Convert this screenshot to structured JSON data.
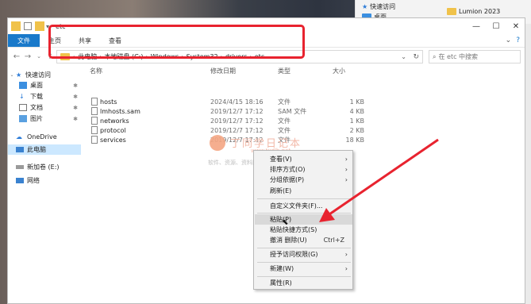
{
  "background": {
    "right_panel_items": [
      "快速访问",
      "桌面",
      "Lumion 2023"
    ]
  },
  "window": {
    "title": "etc",
    "ribbon_tabs": [
      "文件",
      "主页",
      "共享",
      "查看"
    ],
    "address": {
      "crumbs": [
        "此电脑",
        "本地磁盘 (C:)",
        "Windows",
        "System32",
        "drivers",
        "etc"
      ]
    },
    "search_placeholder": "在 etc 中搜索"
  },
  "sidebar": {
    "items": [
      {
        "label": "快速访问",
        "icon": "star-icon"
      },
      {
        "label": "桌面",
        "icon": "desktop-folder-icon"
      },
      {
        "label": "下载",
        "icon": "download-icon"
      },
      {
        "label": "文档",
        "icon": "document-icon"
      },
      {
        "label": "图片",
        "icon": "picture-icon"
      },
      {
        "label": "OneDrive",
        "icon": "cloud-icon"
      },
      {
        "label": "此电脑",
        "icon": "computer-icon"
      },
      {
        "label": "新加卷 (E:)",
        "icon": "drive-icon"
      },
      {
        "label": "网络",
        "icon": "network-icon"
      }
    ]
  },
  "filelist": {
    "columns": [
      "名称",
      "修改日期",
      "类型",
      "大小"
    ],
    "rows": [
      {
        "name": "hosts",
        "date": "2024/4/15 18:16",
        "type": "文件",
        "size": "1 KB"
      },
      {
        "name": "lmhosts.sam",
        "date": "2019/12/7 17:12",
        "type": "SAM 文件",
        "size": "4 KB"
      },
      {
        "name": "networks",
        "date": "2019/12/7 17:12",
        "type": "文件",
        "size": "1 KB"
      },
      {
        "name": "protocol",
        "date": "2019/12/7 17:12",
        "type": "文件",
        "size": "2 KB"
      },
      {
        "name": "services",
        "date": "2019/12/7 17:12",
        "type": "文件",
        "size": "18 KB"
      }
    ]
  },
  "watermark": {
    "title": "丁同学日记本",
    "url": "www.txdlb.net",
    "subtitle": "软件、资源、资料网盘直链分享下载"
  },
  "context_menu": {
    "items": [
      {
        "label": "查看(V)",
        "submenu": true
      },
      {
        "label": "排序方式(O)",
        "submenu": true
      },
      {
        "label": "分组依据(P)",
        "submenu": true
      },
      {
        "label": "刷新(E)",
        "submenu": false
      },
      {
        "label": "自定义文件夹(F)...",
        "submenu": false
      },
      {
        "label": "粘贴(P)",
        "submenu": false
      },
      {
        "label": "粘贴快捷方式(S)",
        "submenu": false
      },
      {
        "label": "撤消 删除(U)",
        "submenu": false,
        "shortcut": "Ctrl+Z"
      },
      {
        "label": "授予访问权限(G)",
        "submenu": true
      },
      {
        "label": "新建(W)",
        "submenu": true
      },
      {
        "label": "属性(R)",
        "submenu": false
      }
    ]
  },
  "colors": {
    "accent": "#1979ca",
    "highlight_box": "#e8232f",
    "arrow": "#e8232f",
    "selection": "#cce8ff"
  }
}
